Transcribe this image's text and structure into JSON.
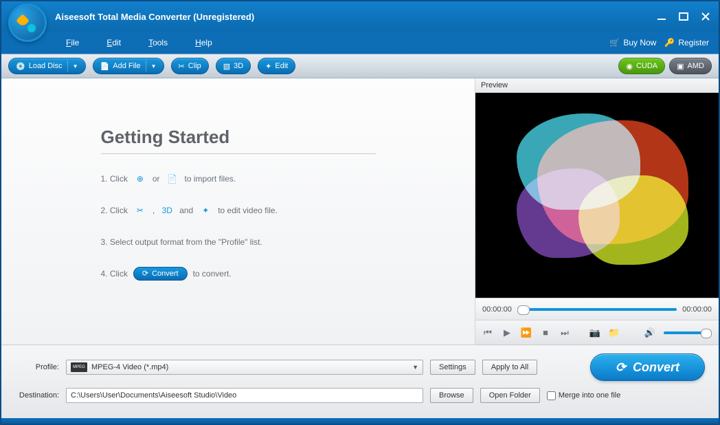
{
  "title": "Aiseesoft Total Media Converter (Unregistered)",
  "menu": {
    "file": "File",
    "edit": "Edit",
    "tools": "Tools",
    "help": "Help"
  },
  "header": {
    "buy": "Buy Now",
    "register": "Register"
  },
  "toolbar": {
    "loadDisc": "Load Disc",
    "addFile": "Add File",
    "clip": "Clip",
    "threeD": "3D",
    "edit": "Edit",
    "cuda": "CUDA",
    "amd": "AMD"
  },
  "getting": {
    "title": "Getting Started",
    "step1a": "1. Click",
    "step1or": "or",
    "step1b": "to import files.",
    "step2a": "2. Click",
    "step2comma": ",",
    "step2and": "and",
    "step2b": "to edit video file.",
    "step3": "3. Select output format from the \"Profile\" list.",
    "step4a": "4. Click",
    "step4convert": "Convert",
    "step4b": "to convert."
  },
  "preview": {
    "label": "Preview",
    "timeStart": "00:00:00",
    "timeEnd": "00:00:00"
  },
  "bottom": {
    "profileLabel": "Profile:",
    "profileValue": "MPEG-4 Video (*.mp4)",
    "settings": "Settings",
    "applyAll": "Apply to All",
    "destLabel": "Destination:",
    "destValue": "C:\\Users\\User\\Documents\\Aiseesoft Studio\\Video",
    "browse": "Browse",
    "openFolder": "Open Folder",
    "merge": "Merge into one file",
    "convert": "Convert"
  }
}
